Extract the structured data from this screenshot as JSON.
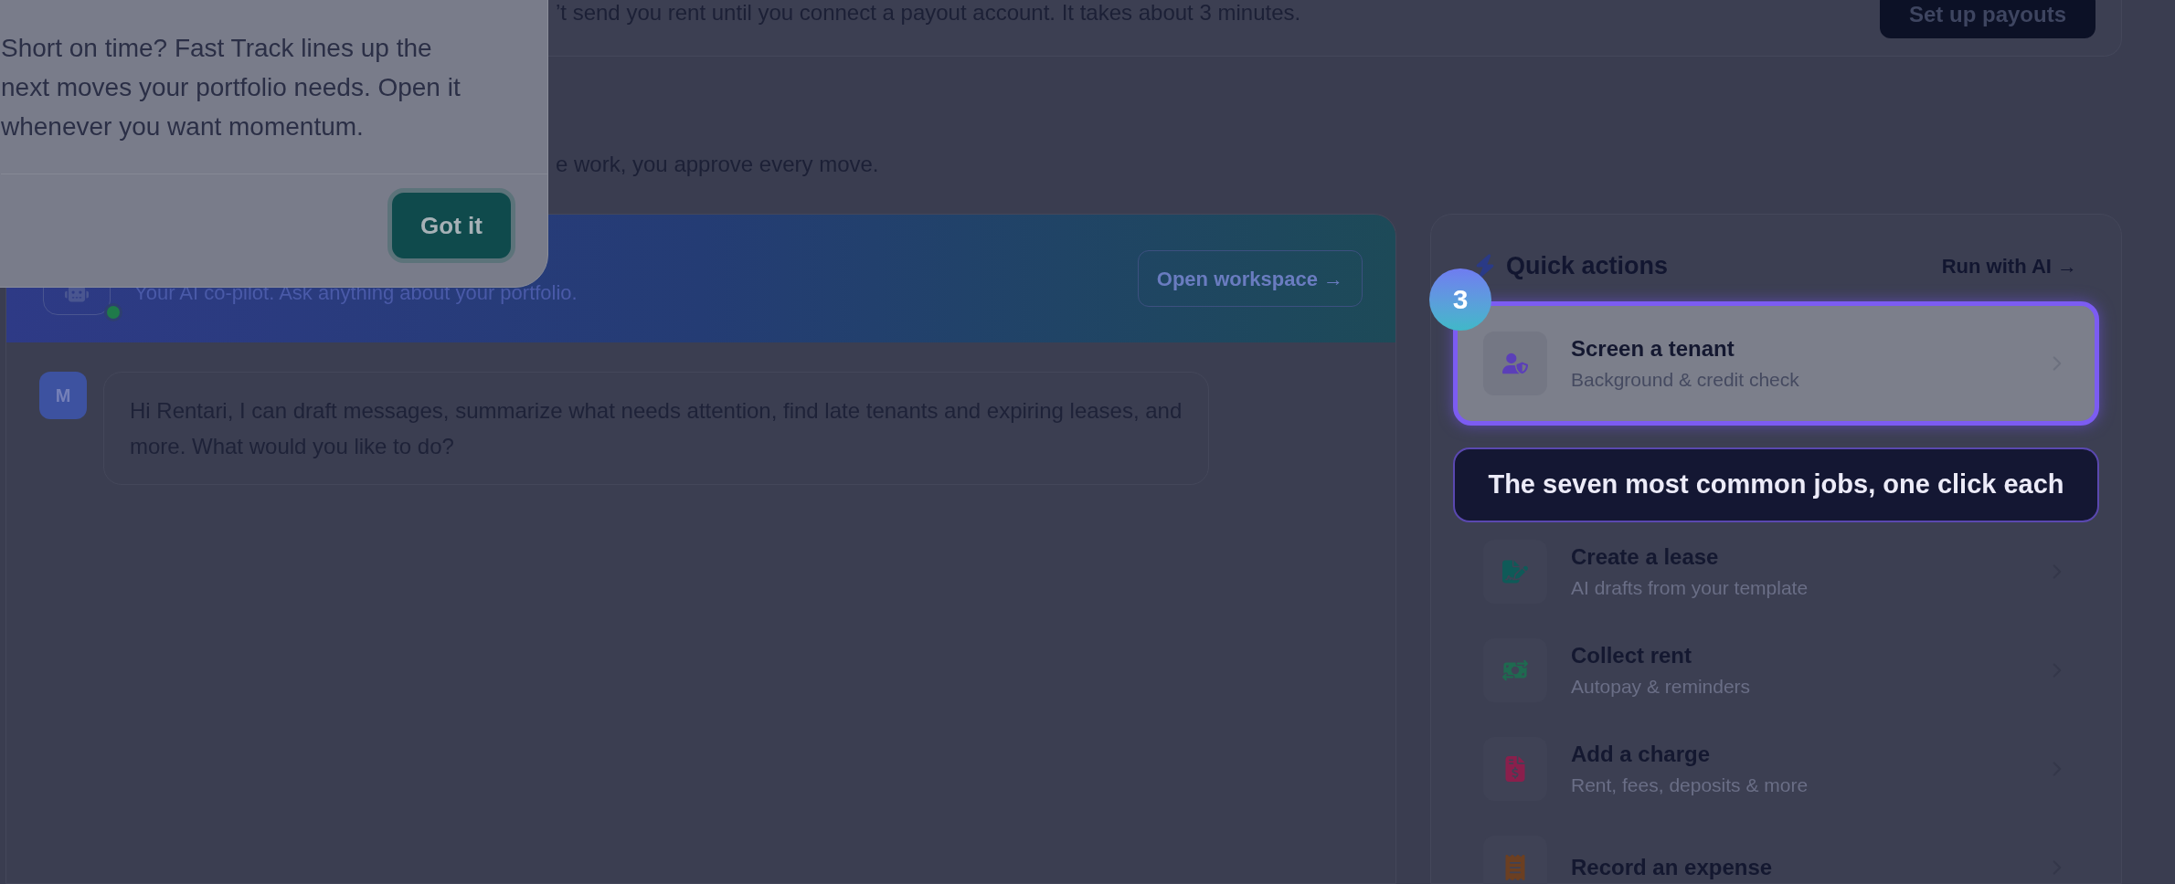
{
  "onboarding_popover": {
    "body": "Short on time? Fast Track lines up the next moves your portfolio needs. Open it whenever you want momentum.",
    "button": "Got it"
  },
  "payout_banner": {
    "message": "’t send you rent until you connect a payout account. It takes about 3 minutes.",
    "button": "Set up payouts"
  },
  "section_subtitle": "e work, you approve every move.",
  "assistant": {
    "subtitle": "Your AI co-pilot. Ask anything about your portfolio.",
    "online": true,
    "button": "Open workspace →",
    "messages": [
      {
        "avatar": "M",
        "text": "Hi Rentari, I can draft messages, summarize what needs attention, find late tenants and expiring leases, and more. What would you like to do?"
      }
    ]
  },
  "quick_actions": {
    "title": "Quick actions",
    "link": "Run with AI →",
    "tour_step": "3",
    "tooltip": "The seven most common jobs, one click each",
    "items": [
      {
        "title": "Screen a tenant",
        "subtitle": "Background & credit check",
        "highlighted": true,
        "color": "#5b3fb8"
      },
      {
        "title": "Create a lease",
        "subtitle": "AI drafts from your template",
        "highlighted": false,
        "color": "#0f5a58"
      },
      {
        "title": "Collect rent",
        "subtitle": "Autopay & reminders",
        "highlighted": false,
        "color": "#1f6a50"
      },
      {
        "title": "Add a charge",
        "subtitle": "Rent, fees, deposits & more",
        "highlighted": false,
        "color": "#8a1f4c"
      },
      {
        "title": "Record an expense",
        "highlighted": false,
        "color": "#6b3f22"
      }
    ]
  }
}
